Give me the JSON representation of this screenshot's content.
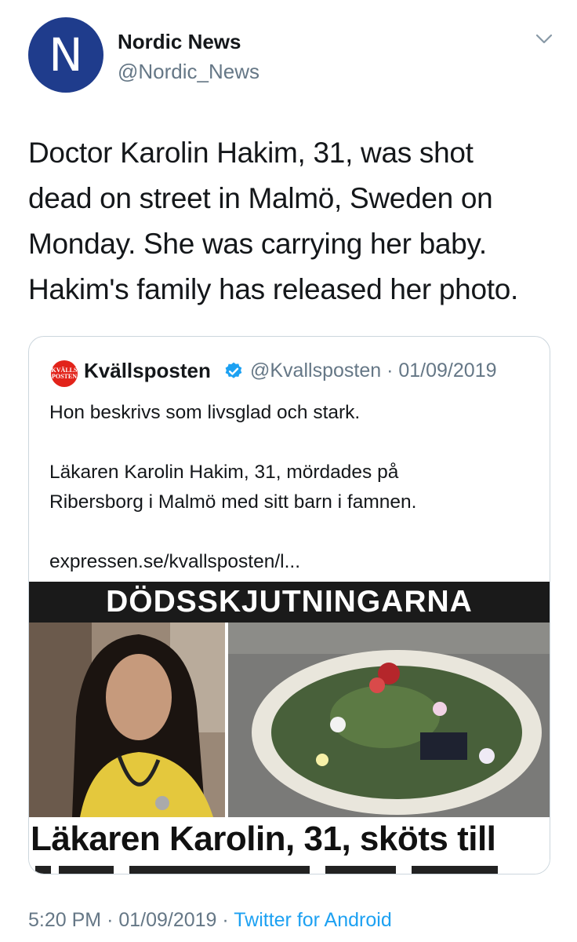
{
  "tweet": {
    "author": {
      "avatar_letter": "N",
      "display_name": "Nordic News",
      "handle": "@Nordic_News",
      "avatar_color": "#1f3c8c"
    },
    "text_lines": [
      "Doctor Karolin Hakim, 31, was shot",
      "dead on street in Malmö, Sweden on",
      "Monday. She was carrying her baby.",
      "Hakim's family has released her photo."
    ],
    "menu_icon": "chevron-down-icon"
  },
  "quoted_tweet": {
    "logo_line1": "KVÄLLS",
    "logo_line2": "POSTEN",
    "display_name": "Kvällsposten",
    "verified_icon": "verified-badge-icon",
    "handle": "@Kvallsposten",
    "separator": "·",
    "date": "01/09/2019",
    "text_line1": "Hon beskrivs som livsglad och stark.",
    "text_line2": "Läkaren Karolin Hakim, 31, mördades på",
    "text_line3": "Ribersborg i Malmö med sitt barn i famnen.",
    "link": "expressen.se/kvallsposten/l...",
    "media": {
      "banner": "DÖDSSKJUTNINGARNA",
      "headline": "Läkaren Karolin, 31, sköts till"
    }
  },
  "footer": {
    "time": "5:20 PM",
    "sep1": "·",
    "date": "01/09/2019",
    "sep2": "·",
    "source": "Twitter for Android"
  },
  "colors": {
    "link_blue": "#1da1f2",
    "muted_gray": "#657786",
    "kvallsposten_red": "#e2231a"
  }
}
